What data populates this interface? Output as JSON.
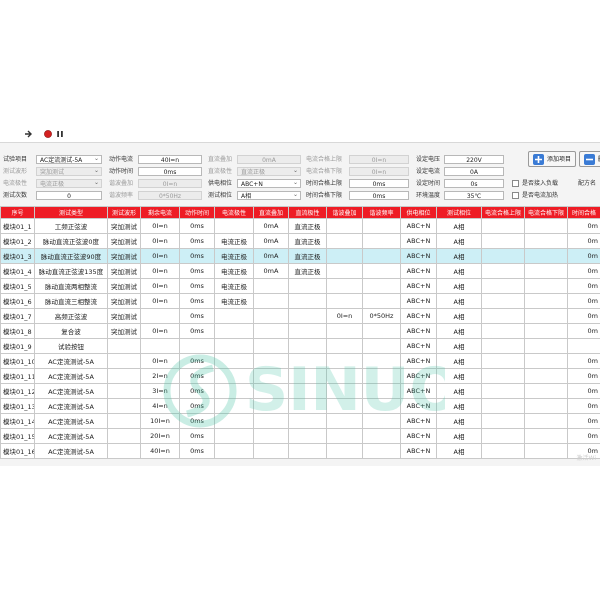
{
  "toolbar": {
    "icons": [
      "arrow-icon",
      "record-icon",
      "pause-icon"
    ]
  },
  "form": {
    "rows": [
      [
        {
          "label": "试验项目",
          "value": "AC定流测试-5A",
          "type": "select",
          "enabled": true
        },
        {
          "label": "动作电流",
          "value": "40I=n",
          "type": "field",
          "enabled": true
        },
        {
          "label": "直流叠加",
          "value": "0mA",
          "type": "field",
          "enabled": false
        },
        {
          "label": "电流合格上限",
          "value": "0I=n",
          "type": "field",
          "enabled": false
        },
        {
          "label": "设定电压",
          "value": "220V",
          "type": "field",
          "enabled": true
        }
      ],
      [
        {
          "label": "测试波形",
          "value": "突加测试",
          "type": "select",
          "enabled": false
        },
        {
          "label": "动作时间",
          "value": "0ms",
          "type": "field",
          "enabled": true
        },
        {
          "label": "直流极性",
          "value": "直流正极",
          "type": "select",
          "enabled": false
        },
        {
          "label": "电流合格下限",
          "value": "0I=n",
          "type": "field",
          "enabled": false
        },
        {
          "label": "设定电流",
          "value": "0A",
          "type": "field",
          "enabled": true
        }
      ],
      [
        {
          "label": "电流极性",
          "value": "电流正极",
          "type": "select",
          "enabled": false
        },
        {
          "label": "谐波叠加",
          "value": "0I=n",
          "type": "field",
          "enabled": false
        },
        {
          "label": "供电相位",
          "value": "ABC+N",
          "type": "select",
          "enabled": true
        },
        {
          "label": "时间合格上限",
          "value": "0ms",
          "type": "field",
          "enabled": true
        },
        {
          "label": "设定时间",
          "value": "0s",
          "type": "field",
          "enabled": true
        }
      ],
      [
        {
          "label": "测试次数",
          "value": "0",
          "type": "field",
          "enabled": true
        },
        {
          "label": "谐波频率",
          "value": "0*50Hz",
          "type": "field",
          "enabled": false
        },
        {
          "label": "测试相位",
          "value": "A相",
          "type": "select",
          "enabled": true
        },
        {
          "label": "时间合格下限",
          "value": "0ms",
          "type": "field",
          "enabled": true
        },
        {
          "label": "环境温度",
          "value": "35℃",
          "type": "field",
          "enabled": true
        }
      ]
    ],
    "checkboxes": [
      "是否接入负载",
      "是否电流加热"
    ],
    "right_label": "配方名",
    "add_button": "添加项目",
    "delete_button": "删"
  },
  "table": {
    "columns": [
      "序号",
      "测试类型",
      "测试波形",
      "剩余电流",
      "动作时间",
      "电流极性",
      "直流叠加",
      "直流极性",
      "谐波叠加",
      "谐波频率",
      "供电相位",
      "测试相位",
      "电流合格上限",
      "电流合格下限",
      "时间合格"
    ],
    "rows": [
      [
        "模块01_1",
        "工频正弦波",
        "突加测试",
        "0I=n",
        "0ms",
        "",
        "0mA",
        "直流正极",
        "",
        "",
        "ABC+N",
        "A相",
        "",
        "",
        "0m"
      ],
      [
        "模块01_2",
        "脉动直流正弦波0度",
        "突加测试",
        "0I=n",
        "0ms",
        "电流正极",
        "0mA",
        "直流正极",
        "",
        "",
        "ABC+N",
        "A相",
        "",
        "",
        "0m"
      ],
      [
        "模块01_3",
        "脉动直流正弦波90度",
        "突加测试",
        "0I=n",
        "0ms",
        "电流正极",
        "0mA",
        "直流正极",
        "",
        "",
        "ABC+N",
        "A相",
        "",
        "",
        "0m"
      ],
      [
        "模块01_4",
        "脉动直流正弦波135度",
        "突加测试",
        "0I=n",
        "0ms",
        "电流正极",
        "0mA",
        "直流正极",
        "",
        "",
        "ABC+N",
        "A相",
        "",
        "",
        "0m"
      ],
      [
        "模块01_5",
        "脉动直流两相整流",
        "突加测试",
        "0I=n",
        "0ms",
        "电流正极",
        "",
        "",
        "",
        "",
        "ABC+N",
        "A相",
        "",
        "",
        "0m"
      ],
      [
        "模块01_6",
        "脉动直流三相整流",
        "突加测试",
        "0I=n",
        "0ms",
        "电流正极",
        "",
        "",
        "",
        "",
        "ABC+N",
        "A相",
        "",
        "",
        "0m"
      ],
      [
        "模块01_7",
        "高频正弦波",
        "突加测试",
        "",
        "0ms",
        "",
        "",
        "",
        "0I=n",
        "0*50Hz",
        "ABC+N",
        "A相",
        "",
        "",
        "0m"
      ],
      [
        "模块01_8",
        "复合波",
        "突加测试",
        "0I=n",
        "0ms",
        "",
        "",
        "",
        "",
        "",
        "ABC+N",
        "A相",
        "",
        "",
        "0m"
      ],
      [
        "模块01_9",
        "试验按钮",
        "",
        "",
        "",
        "",
        "",
        "",
        "",
        "",
        "ABC+N",
        "A相",
        "",
        "",
        ""
      ],
      [
        "模块01_10",
        "AC定流测试-5A",
        "",
        "0I=n",
        "0ms",
        "",
        "",
        "",
        "",
        "",
        "ABC+N",
        "A相",
        "",
        "",
        "0m"
      ],
      [
        "模块01_11",
        "AC定流测试-5A",
        "",
        "2I=n",
        "0ms",
        "",
        "",
        "",
        "",
        "",
        "ABC+N",
        "A相",
        "",
        "",
        "0m"
      ],
      [
        "模块01_12",
        "AC定流测试-5A",
        "",
        "3I=n",
        "0ms",
        "",
        "",
        "",
        "",
        "",
        "ABC+N",
        "A相",
        "",
        "",
        "0m"
      ],
      [
        "模块01_13",
        "AC定流测试-5A",
        "",
        "4I=n",
        "0ms",
        "",
        "",
        "",
        "",
        "",
        "ABC+N",
        "A相",
        "",
        "",
        "0m"
      ],
      [
        "模块01_14",
        "AC定流测试-5A",
        "",
        "10I=n",
        "0ms",
        "",
        "",
        "",
        "",
        "",
        "ABC+N",
        "A相",
        "",
        "",
        "0m"
      ],
      [
        "模块01_15",
        "AC定流测试-5A",
        "",
        "20I=n",
        "0ms",
        "",
        "",
        "",
        "",
        "",
        "ABC+N",
        "A相",
        "",
        "",
        "0m"
      ],
      [
        "模块01_16",
        "AC定流测试-5A",
        "",
        "40I=n",
        "0ms",
        "",
        "",
        "",
        "",
        "",
        "ABC+N",
        "A相",
        "",
        "",
        "0m"
      ]
    ],
    "highlighted_row": 2
  },
  "colors": {
    "header_bg": "#ee1c25",
    "highlight_row": "#cdeff6",
    "record": "#d42020",
    "add_icon": "#3a7bd5"
  },
  "watermark": "SINUO",
  "corner_mark": "激活Wi"
}
